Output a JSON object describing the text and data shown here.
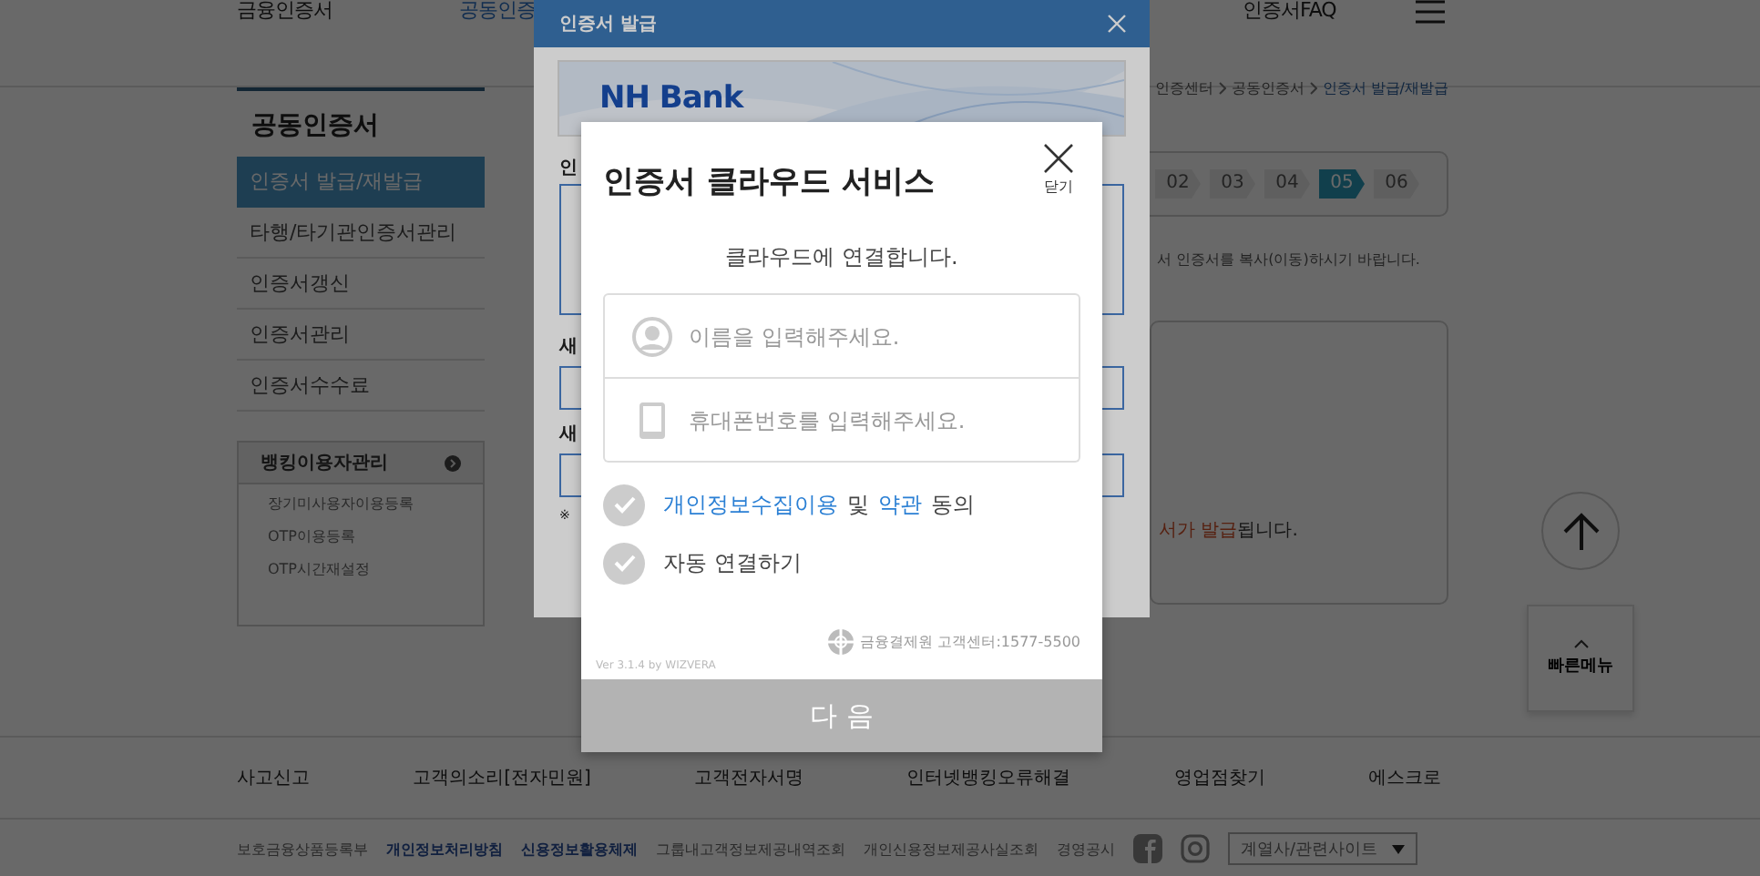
{
  "top_nav": {
    "items": [
      {
        "label": "금융인증서",
        "selected": false
      },
      {
        "label": "공동인증",
        "selected": true
      },
      {
        "label": "인증서FAQ",
        "selected": false
      }
    ]
  },
  "sidebar": {
    "title": "공동인증서",
    "items": [
      {
        "label": "인증서 발급/재발급",
        "selected": true
      },
      {
        "label": "타행/타기관인증서관리",
        "selected": false
      },
      {
        "label": "인증서갱신",
        "selected": false
      },
      {
        "label": "인증서관리",
        "selected": false
      },
      {
        "label": "인증서수수료",
        "selected": false
      }
    ],
    "panel": {
      "title": "뱅킹이용자관리",
      "items": [
        "장기미사용자이용등록",
        "OTP이용등록",
        "OTP시간재설정"
      ]
    }
  },
  "breadcrumb": [
    "인증센터",
    "공동인증서",
    "인증서 발급/재발급"
  ],
  "steps": [
    {
      "label": "02",
      "selected": false
    },
    {
      "label": "03",
      "selected": false
    },
    {
      "label": "04",
      "selected": false
    },
    {
      "label": "05",
      "selected": true
    },
    {
      "label": "06",
      "selected": false
    }
  ],
  "instruction": "서 인증서를 복사(이동)하시기 바랍니다.",
  "notice": {
    "highlight": "서가 발급",
    "rest": "됩니다."
  },
  "quick_menu": {
    "label": "빠른메뉴"
  },
  "footer": {
    "links": [
      "사고신고",
      "고객의소리[전자민원]",
      "고객전자서명",
      "인터넷뱅킹오류해결",
      "영업점찾기",
      "에스크로"
    ],
    "policies": [
      {
        "label": "보호금융상품등록부",
        "emphasis": false
      },
      {
        "label": "개인정보처리방침",
        "emphasis": true
      },
      {
        "label": "신용정보활용체제",
        "emphasis": true
      },
      {
        "label": "그룹내고객정보제공내역조회",
        "emphasis": false
      },
      {
        "label": "개인신용정보제공사실조회",
        "emphasis": false
      },
      {
        "label": "경영공시",
        "emphasis": false
      }
    ],
    "family_select": "계열사/관련사이트"
  },
  "issue_dialog": {
    "title": "인증서 발급",
    "logo": "NH Bank",
    "labels": [
      "인",
      "새",
      "새"
    ],
    "note": "※"
  },
  "cloud_dialog": {
    "title": "인증서 클라우드 서비스",
    "close_label": "닫기",
    "subtitle": "클라우드에 연결합니다.",
    "fields": [
      {
        "kind": "name",
        "placeholder": "이름을 입력해주세요."
      },
      {
        "kind": "phone",
        "placeholder": "휴대폰번호를 입력해주세요."
      }
    ],
    "options": [
      {
        "checked": false,
        "parts": [
          {
            "text": "개인정보수집이용",
            "link": true
          },
          {
            "text": "및",
            "link": false
          },
          {
            "text": "약관",
            "link": true
          },
          {
            "text": "동의",
            "link": false
          }
        ]
      },
      {
        "checked": false,
        "parts": [
          {
            "text": "자동 연결하기",
            "link": false
          }
        ]
      }
    ],
    "provider": "금융결제원 고객센터:1577-5500",
    "version": "Ver 3.1.4 by WIZVERA",
    "next_button": "다 음"
  }
}
